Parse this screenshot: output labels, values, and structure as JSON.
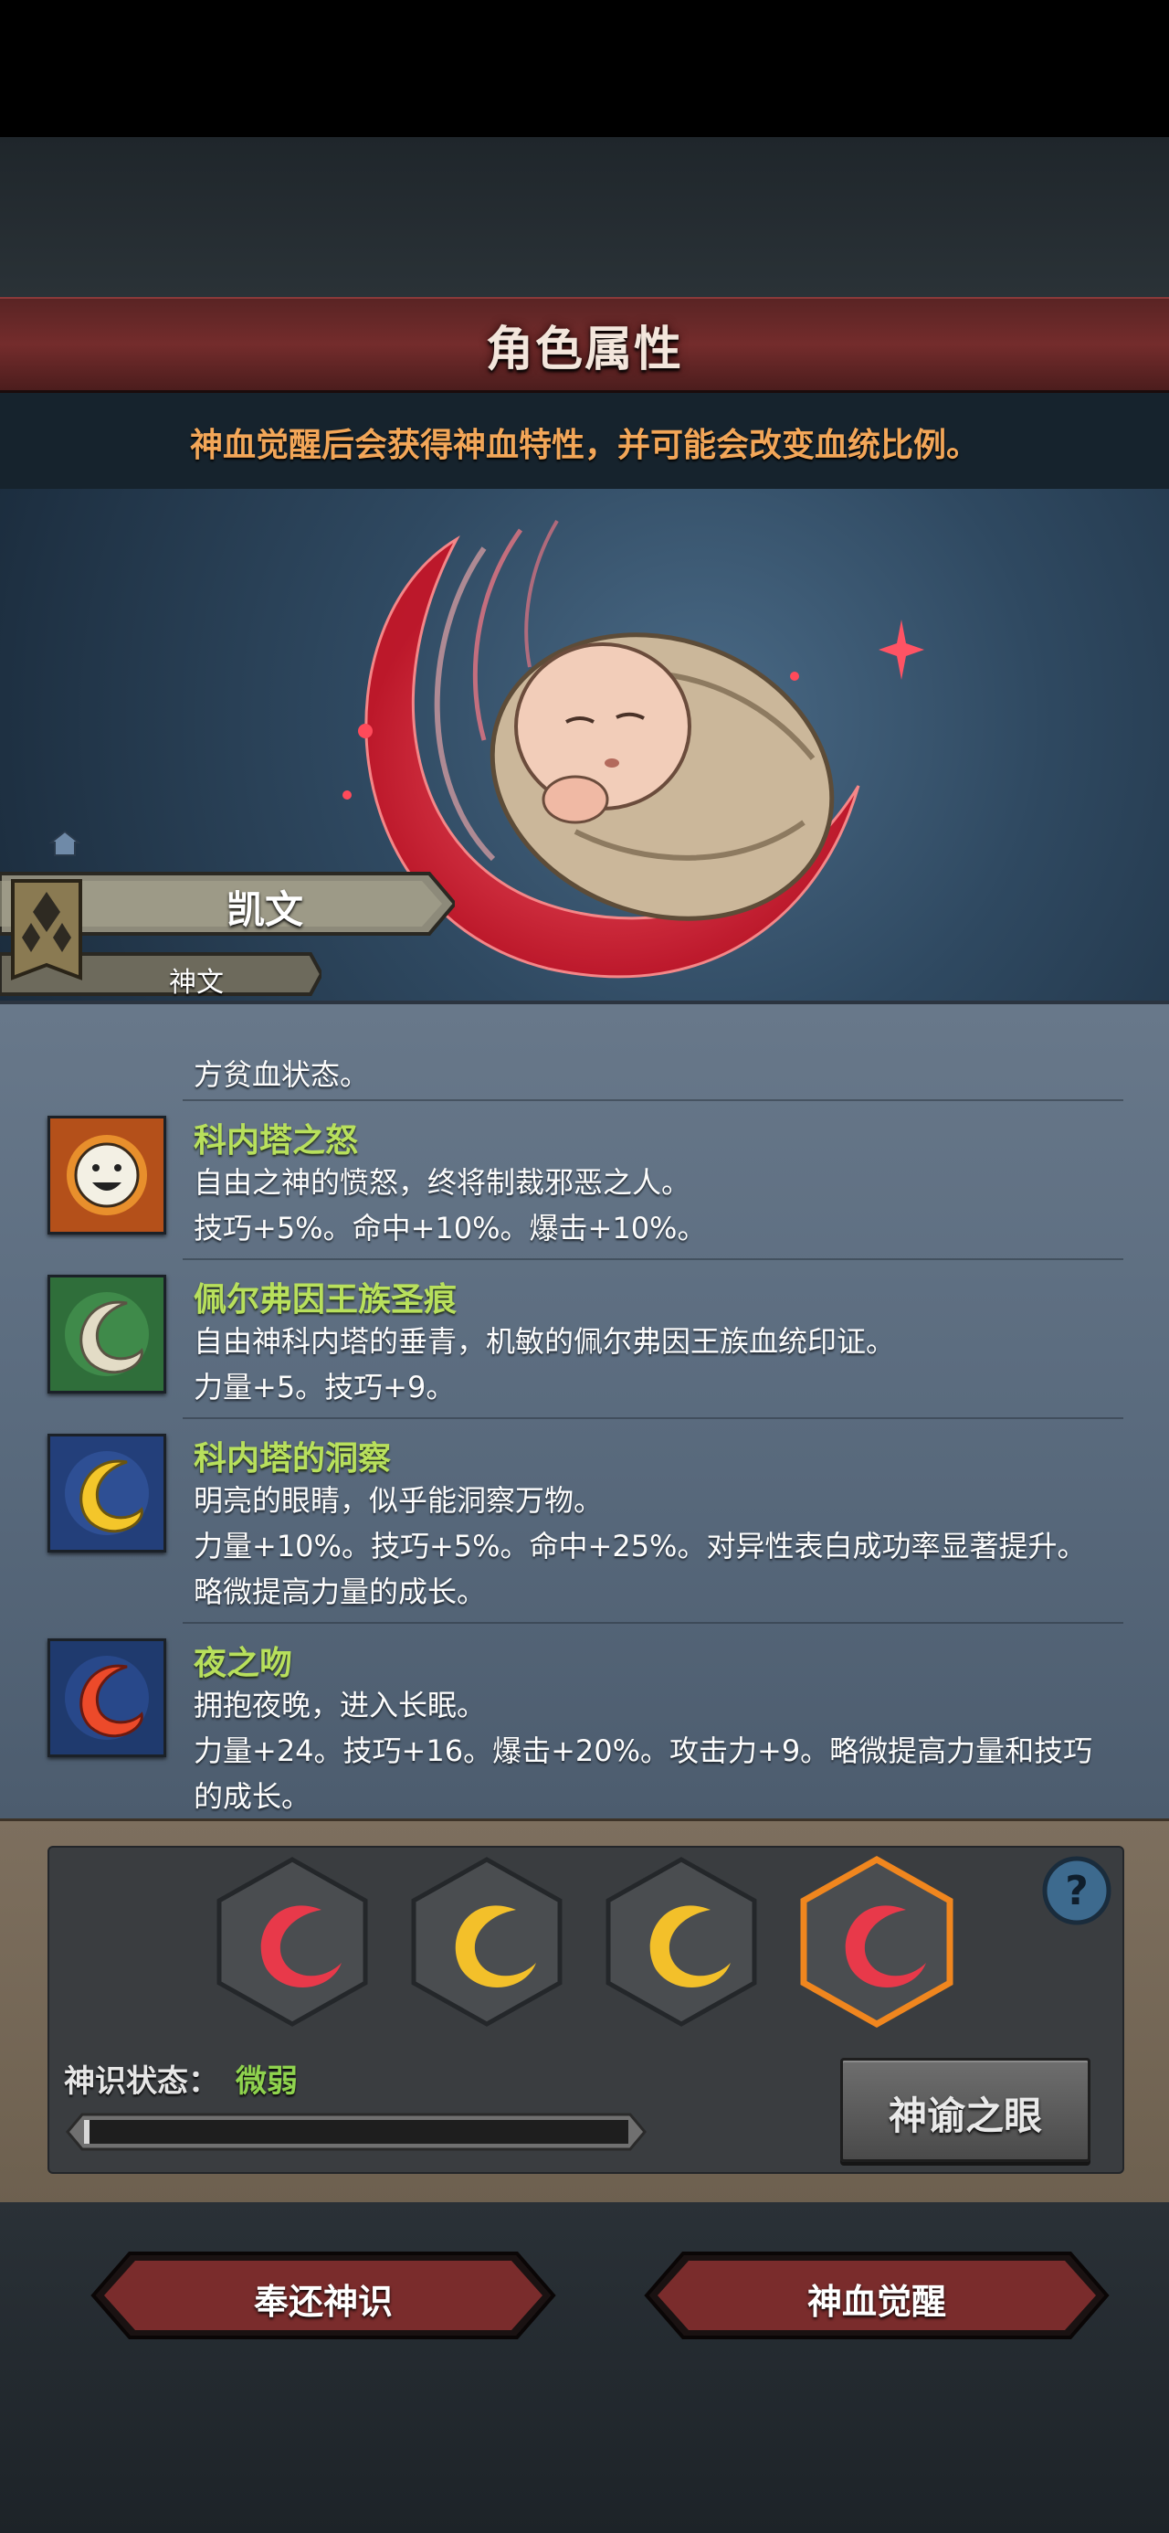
{
  "header": {
    "title": "角色属性",
    "hint": "神血觉醒后会获得神血特性，并可能会改变血统比例。"
  },
  "character": {
    "name": "凯文",
    "rank_title": "神文"
  },
  "traits": {
    "partial_line": "方贫血状态。",
    "items": [
      {
        "name": "科内塔之怒",
        "icon": "smiling-sun-icon",
        "lines": [
          "自由之神的愤怒，终将制裁邪恶之人。",
          "技巧+5%。命中+10%。爆击+10%。"
        ]
      },
      {
        "name": "佩尔弗因王族圣痕",
        "icon": "white-crescent-icon",
        "lines": [
          "自由神科内塔的垂青，机敏的佩尔弗因王族血统印证。",
          "力量+5。技巧+9。"
        ]
      },
      {
        "name": "科内塔的洞察",
        "icon": "golden-crescent-icon",
        "lines": [
          "明亮的眼睛，似乎能洞察万物。",
          "力量+10%。技巧+5%。命中+25%。对异性表白成功率显著提升。",
          "略微提高力量的成长。"
        ]
      },
      {
        "name": "夜之吻",
        "icon": "red-crescent-icon",
        "lines": [
          "拥抱夜晚，进入长眠。",
          "力量+24。技巧+16。爆击+20%。攻击力+9。略微提高力量和技巧",
          "的成长。"
        ]
      }
    ]
  },
  "awakening": {
    "slots": [
      {
        "color": "red",
        "selected": false
      },
      {
        "color": "gold",
        "selected": false
      },
      {
        "color": "gold",
        "selected": false
      },
      {
        "color": "red",
        "selected": true
      }
    ],
    "state_label": "神识状态：",
    "state_value": "微弱",
    "progress": 0.01,
    "oracle_button": "神谕之眼"
  },
  "actions": {
    "return_button": "奉还神识",
    "awaken_button": "神血觉醒"
  },
  "colors": {
    "trait_name": "#b8e05c",
    "hint": "#f2a658",
    "state_value": "#8fd34e",
    "accent_red": "#e8394a",
    "accent_gold": "#f3c02a"
  }
}
